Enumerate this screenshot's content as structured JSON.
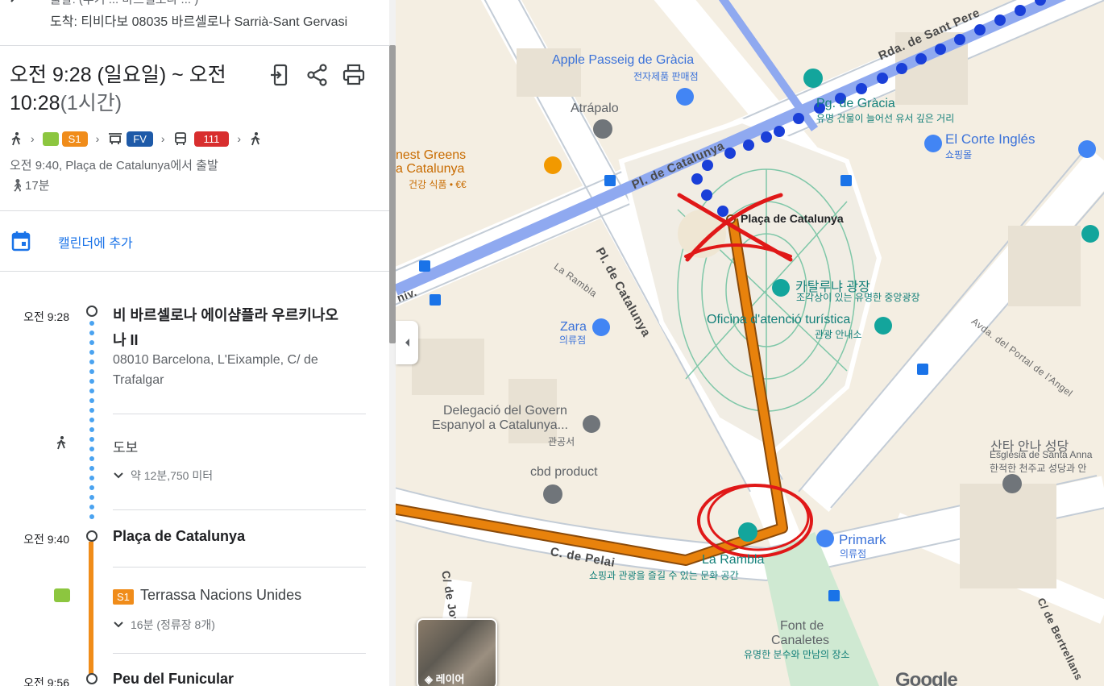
{
  "header": {
    "dest_line1": "출발: (부기 ... 바르셀로나 ... )",
    "dest_line2": "도착: 티비다보 08035 바르셀로나 Sarrià-Sant Gervasi"
  },
  "summary": {
    "time_range": "오전 9:28 (일요일) ~ 오전 10:28",
    "duration": "(1시간)",
    "route": {
      "s1_badge": "S1",
      "fv_badge": "FV",
      "bus_badge": "111"
    },
    "depart": "오전 9:40, Plaça de Catalunya에서 출발",
    "walk_total": "17분"
  },
  "calendar": {
    "label": "캘린더에 추가"
  },
  "timeline": {
    "stop1": {
      "time": "오전 9:28",
      "name": "비 바르셀로나 에이샴플라 우르키나오나 II",
      "name_line1": "비 바르셀로나 에이샴플라 우르키나오",
      "name_line2": "나 II",
      "addr_line1": "08010 Barcelona, L'Eixample, C/ de",
      "addr_line2": "Trafalgar"
    },
    "walk": {
      "label": "도보",
      "sub": "약 12분,750 미터"
    },
    "stop2": {
      "time": "오전 9:40",
      "name": "Plaça de Catalunya"
    },
    "train": {
      "badge": "S1",
      "direction": "Terrassa Nacions Unides",
      "sub": "16분 (정류장 8개)"
    },
    "stop3": {
      "time": "오전 9:56",
      "name": "Peu del Funicular"
    }
  },
  "map": {
    "labels": {
      "apple": "Apple Passeig de Gràcia",
      "apple_sub": "전자제품 판매점",
      "atrapalo": "Atrápalo",
      "honest1": "nest Greens",
      "honest2": "a Catalunya",
      "honest_sub": "건강 식품 • €€",
      "pg_gracia": "Pg. de Gràcia",
      "pg_gracia_sub": "유명 건물이 늘어선 유서 깊은 거리",
      "corte": "El Corte Inglés",
      "corte_sub": "쇼핑몰",
      "placa": "Plaça de Catalunya",
      "cat_square": "카탈루냐 광장",
      "cat_square_sub": "조각상이 있는 유명한 중앙광장",
      "oficina": "Oficina d'atenció turística",
      "oficina_sub": "관광 안내소",
      "zara": "Zara",
      "zara_sub": "의류점",
      "delegacio1": "Delegació del Govern",
      "delegacio2": "Espanyol a Catalunya...",
      "delegacio_sub": "관공서",
      "cbd": "cbd product",
      "santa1": "산타 안나 성당",
      "santa2": "Església de Santa Anna",
      "santa_sub": "한적한 천주교 성당과 안",
      "primark": "Primark",
      "primark_sub": "의류점",
      "larambla": "La Rambla",
      "larambla_sub": "쇼핑과 관광을 즐길 수 있는 문화 공간",
      "font1": "Font de",
      "font2": "Canaletes",
      "font_sub": "유명한 분수와 만남의 장소",
      "layer": "레이어",
      "google": "Google"
    },
    "streets": {
      "rda": "Rda. de Sant Pere",
      "pl_cat": "Pl. de Catalunya",
      "pl_cat2": "Pl. de Catalunya",
      "rambla": "La Rambla",
      "avda": "Avda. del Portal de l'Angel",
      "pelai": "C. de Pelai",
      "jov": "C/ de Jov",
      "bertrellans": "C/ de Bertrellans",
      "univ": "niv."
    }
  },
  "colors": {
    "accent": "#1a73e8",
    "rodalies_green": "#8cc63f",
    "s1_orange": "#f08c1a",
    "fv_blue": "#1e5aa8",
    "bus_red": "#d82e2e",
    "route_orange": "#e8820c",
    "route_blue": "#1a3fd8"
  }
}
